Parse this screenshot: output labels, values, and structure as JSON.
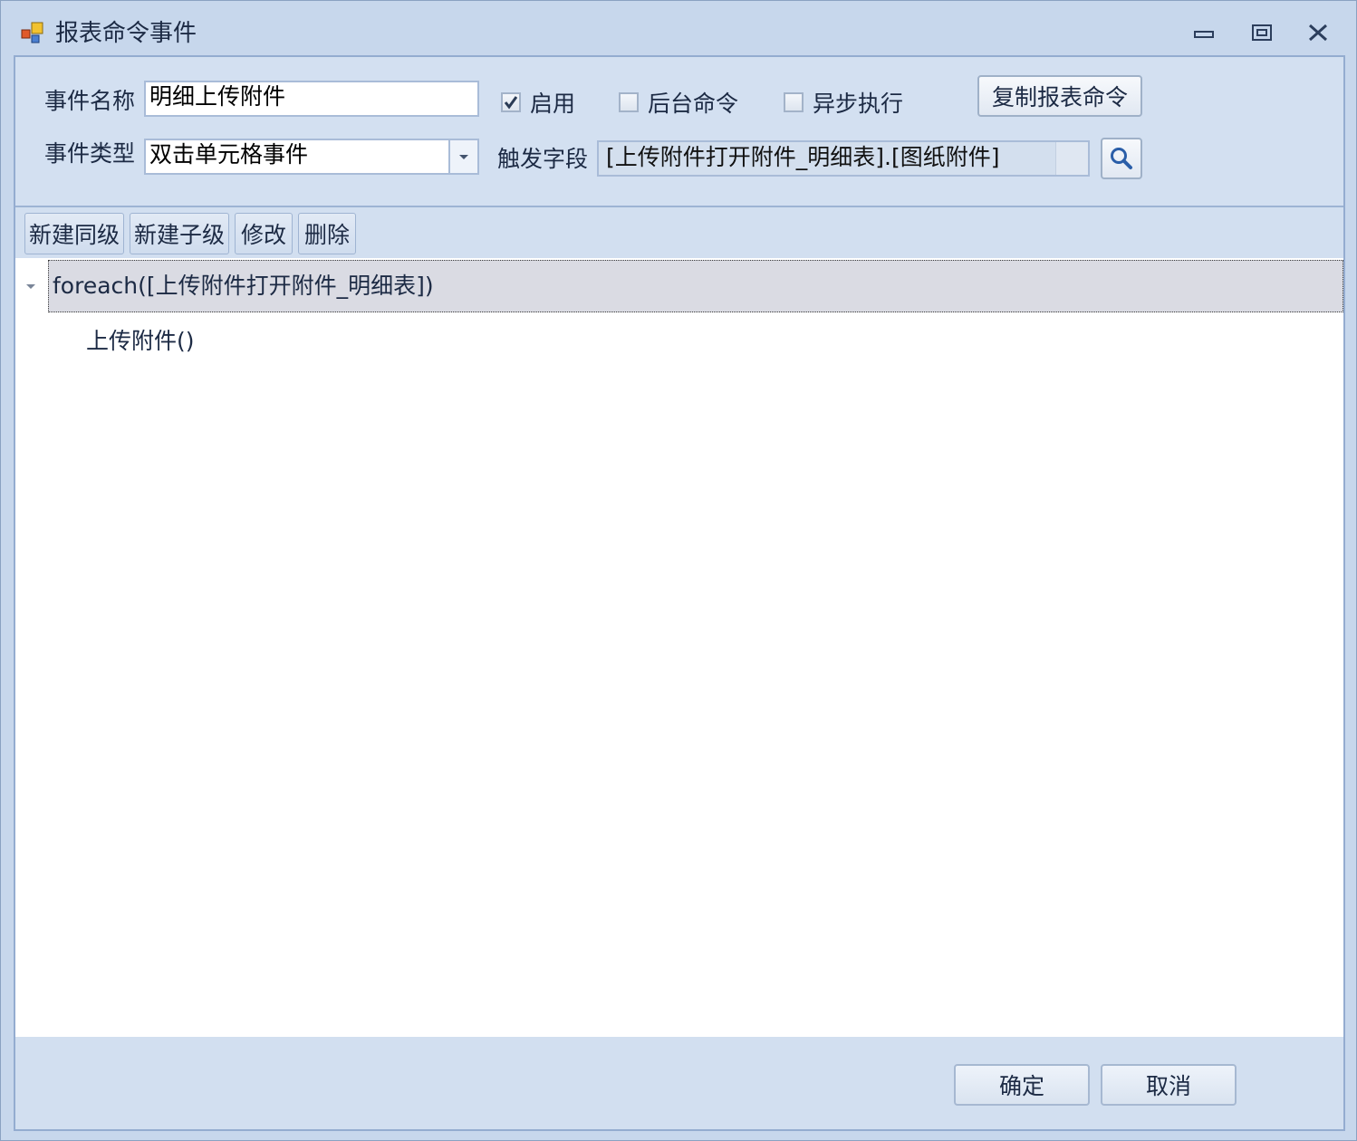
{
  "window": {
    "title": "报表命令事件",
    "accent": "#c7d7ec"
  },
  "top_panel": {
    "event_name_label": "事件名称",
    "event_name_value": "明细上传附件",
    "event_type_label": "事件类型",
    "event_type_value": "双击单元格事件",
    "enable_label": "启用",
    "enable_checked": true,
    "background_cmd_label": "后台命令",
    "async_label": "异步执行",
    "copy_button": "复制报表命令",
    "trigger_field_label": "触发字段",
    "trigger_field_value": "[上传附件打开附件_明细表].[图纸附件]"
  },
  "toolbar": {
    "new_sibling": "新建同级",
    "new_child": "新建子级",
    "modify": "修改",
    "delete": "删除"
  },
  "tree": {
    "root": "foreach([上传附件打开附件_明细表])",
    "child": "上传附件()"
  },
  "footer": {
    "ok": "确定",
    "cancel": "取消"
  }
}
